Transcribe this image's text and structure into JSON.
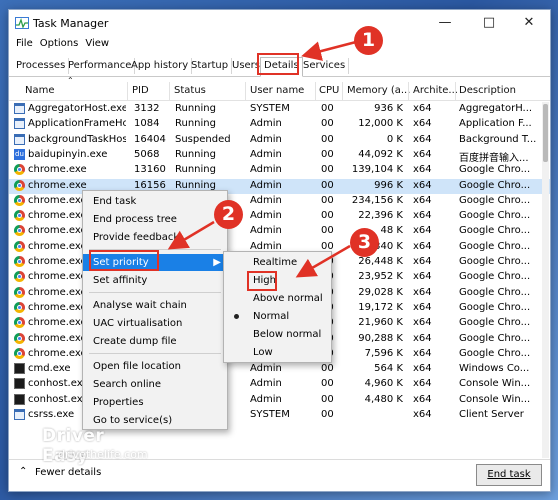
{
  "window": {
    "title": "Task Manager"
  },
  "menu": [
    "File",
    "Options",
    "View"
  ],
  "tabs": [
    "Processes",
    "Performance",
    "App history",
    "Startup",
    "Users",
    "Details",
    "Services"
  ],
  "active_tab": "Details",
  "columns": [
    "Name",
    "PID",
    "Status",
    "User name",
    "CPU",
    "Memory (a...",
    "Archite...",
    "Description"
  ],
  "rows": [
    {
      "name": "AggregatorHost.exe",
      "pid": "3132",
      "status": "Running",
      "user": "SYSTEM",
      "cpu": "00",
      "mem": "936 K",
      "arch": "x64",
      "desc": "AggregatorH...",
      "icon": "app-window-icon"
    },
    {
      "name": "ApplicationFrameHo...",
      "pid": "1084",
      "status": "Running",
      "user": "Admin",
      "cpu": "00",
      "mem": "12,000 K",
      "arch": "x64",
      "desc": "Application F...",
      "icon": "app-window-icon"
    },
    {
      "name": "backgroundTaskHos...",
      "pid": "16404",
      "status": "Suspended",
      "user": "Admin",
      "cpu": "00",
      "mem": "0 K",
      "arch": "x64",
      "desc": "Background T...",
      "icon": "app-window-icon"
    },
    {
      "name": "baidupinyin.exe",
      "pid": "5068",
      "status": "Running",
      "user": "Admin",
      "cpu": "00",
      "mem": "44,092 K",
      "arch": "x64",
      "desc": "百度拼音输入...",
      "icon": "baidu-icon"
    },
    {
      "name": "chrome.exe",
      "pid": "13160",
      "status": "Running",
      "user": "Admin",
      "cpu": "00",
      "mem": "139,104 K",
      "arch": "x64",
      "desc": "Google Chro...",
      "icon": "chrome-icon"
    },
    {
      "name": "chrome.exe",
      "pid": "16156",
      "status": "Running",
      "user": "Admin",
      "cpu": "00",
      "mem": "996 K",
      "arch": "x64",
      "desc": "Google Chro...",
      "icon": "chrome-icon"
    },
    {
      "name": "chrome.exe",
      "pid": "",
      "status": "",
      "user": "Admin",
      "cpu": "00",
      "mem": "234,156 K",
      "arch": "x64",
      "desc": "Google Chro...",
      "icon": "chrome-icon"
    },
    {
      "name": "chrome.exe",
      "pid": "",
      "status": "",
      "user": "Admin",
      "cpu": "00",
      "mem": "22,396 K",
      "arch": "x64",
      "desc": "Google Chro...",
      "icon": "chrome-icon"
    },
    {
      "name": "chrome.exe",
      "pid": "",
      "status": "",
      "user": "Admin",
      "cpu": "00",
      "mem": "48 K",
      "arch": "x64",
      "desc": "Google Chro...",
      "icon": "chrome-icon"
    },
    {
      "name": "chrome.exe",
      "pid": "",
      "status": "",
      "user": "Admin",
      "cpu": "00",
      "mem": "2,340 K",
      "arch": "x64",
      "desc": "Google Chro...",
      "icon": "chrome-icon"
    },
    {
      "name": "chrome.exe",
      "pid": "",
      "status": "",
      "user": "Admin",
      "cpu": "00",
      "mem": "26,448 K",
      "arch": "x64",
      "desc": "Google Chro...",
      "icon": "chrome-icon"
    },
    {
      "name": "chrome.exe",
      "pid": "",
      "status": "",
      "user": "Admin",
      "cpu": "00",
      "mem": "23,952 K",
      "arch": "x64",
      "desc": "Google Chro...",
      "icon": "chrome-icon"
    },
    {
      "name": "chrome.exe",
      "pid": "",
      "status": "",
      "user": "Admin",
      "cpu": "00",
      "mem": "29,028 K",
      "arch": "x64",
      "desc": "Google Chro...",
      "icon": "chrome-icon"
    },
    {
      "name": "chrome.exe",
      "pid": "",
      "status": "",
      "user": "Admin",
      "cpu": "00",
      "mem": "19,172 K",
      "arch": "x64",
      "desc": "Google Chro...",
      "icon": "chrome-icon"
    },
    {
      "name": "chrome.exe",
      "pid": "",
      "status": "",
      "user": "Admin",
      "cpu": "00",
      "mem": "21,960 K",
      "arch": "x64",
      "desc": "Google Chro...",
      "icon": "chrome-icon"
    },
    {
      "name": "chrome.exe",
      "pid": "",
      "status": "",
      "user": "Admin",
      "cpu": "00",
      "mem": "90,288 K",
      "arch": "x64",
      "desc": "Google Chro...",
      "icon": "chrome-icon"
    },
    {
      "name": "chrome.exe",
      "pid": "",
      "status": "",
      "user": "Admin",
      "cpu": "00",
      "mem": "7,596 K",
      "arch": "x64",
      "desc": "Google Chro...",
      "icon": "chrome-icon"
    },
    {
      "name": "cmd.exe",
      "pid": "",
      "status": "",
      "user": "Admin",
      "cpu": "00",
      "mem": "564 K",
      "arch": "x64",
      "desc": "Windows Co...",
      "icon": "cmd-icon"
    },
    {
      "name": "conhost.exe",
      "pid": "",
      "status": "",
      "user": "Admin",
      "cpu": "00",
      "mem": "4,960 K",
      "arch": "x64",
      "desc": "Console Win...",
      "icon": "console-icon"
    },
    {
      "name": "conhost.exe",
      "pid": "",
      "status": "",
      "user": "Admin",
      "cpu": "00",
      "mem": "4,480 K",
      "arch": "x64",
      "desc": "Console Win...",
      "icon": "console-icon"
    },
    {
      "name": "csrss.exe",
      "pid": "",
      "status": "",
      "user": "SYSTEM",
      "cpu": "00",
      "mem": "",
      "arch": "x64",
      "desc": "Client Server",
      "icon": "app-window-icon"
    }
  ],
  "context_menu": {
    "items": [
      "End task",
      "End process tree",
      "Provide feedback",
      "Set priority",
      "Set affinity",
      "Analyse wait chain",
      "UAC virtualisation",
      "Create dump file",
      "Open file location",
      "Search online",
      "Properties",
      "Go to service(s)"
    ],
    "highlighted": "Set priority"
  },
  "priority_submenu": {
    "items": [
      "Realtime",
      "High",
      "Above normal",
      "Normal",
      "Below normal",
      "Low"
    ],
    "selected": "Normal"
  },
  "footer": {
    "fewer_details": "Fewer details",
    "end_task": "End task"
  },
  "annotations": [
    "1",
    "2",
    "3"
  ],
  "watermark": {
    "brand": "Driver Easy",
    "url": "drivethelife.com"
  },
  "colors": {
    "accent_red": "#e03226",
    "selection": "#cfe4f9",
    "menu_highlight": "#1a80e6"
  }
}
